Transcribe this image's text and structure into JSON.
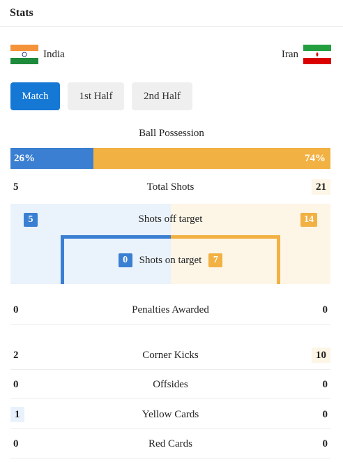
{
  "header": {
    "title": "Stats"
  },
  "teams": {
    "home": {
      "name": "India",
      "flag": "india-flag",
      "color": "#3a7fd2"
    },
    "away": {
      "name": "Iran",
      "flag": "iran-flag",
      "color": "#f2b143"
    }
  },
  "tabs": [
    {
      "label": "Match",
      "active": true
    },
    {
      "label": "1st Half",
      "active": false
    },
    {
      "label": "2nd Half",
      "active": false
    }
  ],
  "possession": {
    "label": "Ball Possession",
    "home": "26%",
    "away": "74%",
    "home_fraction": 0.26
  },
  "total_shots": {
    "label": "Total Shots",
    "home": "5",
    "away": "21"
  },
  "shots_off_target": {
    "label": "Shots off target",
    "home": "5",
    "away": "14"
  },
  "shots_on_target": {
    "label": "Shots on target",
    "home": "0",
    "away": "7"
  },
  "stats": [
    {
      "label": "Penalties Awarded",
      "home": "0",
      "away": "0"
    },
    {
      "label": "Corner Kicks",
      "home": "2",
      "away": "10"
    },
    {
      "label": "Offsides",
      "home": "0",
      "away": "0"
    },
    {
      "label": "Yellow Cards",
      "home": "1",
      "away": "0"
    },
    {
      "label": "Red Cards",
      "home": "0",
      "away": "0"
    }
  ]
}
